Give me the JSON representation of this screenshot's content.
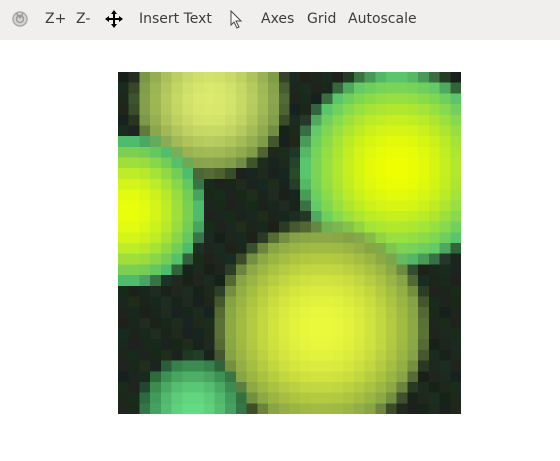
{
  "toolbar": {
    "reset_icon": "reset-view-icon",
    "zoom_in": "Z+",
    "zoom_out": "Z-",
    "pan_icon": "move-arrows-icon",
    "insert_text": "Insert Text",
    "select_icon": "pointer-cursor-icon",
    "axes": "Axes",
    "grid": "Grid",
    "autoscale": "Autoscale"
  }
}
